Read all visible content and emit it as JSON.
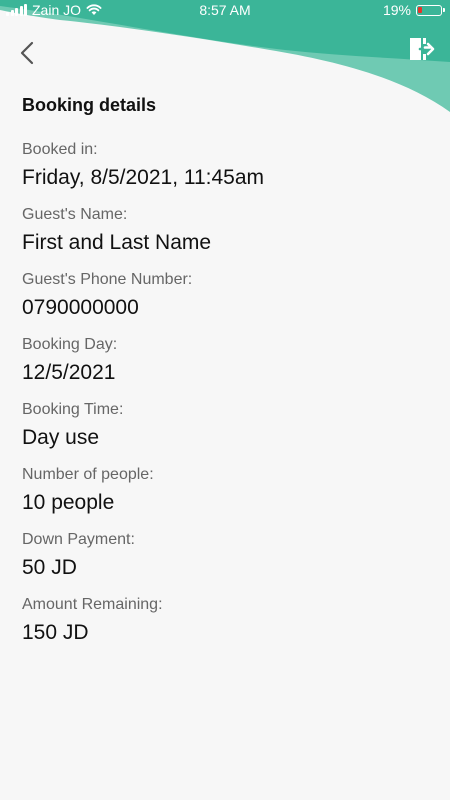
{
  "status_bar": {
    "carrier": "Zain JO",
    "time": "8:57 AM",
    "battery": "19%",
    "battery_level": 0.19
  },
  "header": {
    "title": "Booking details",
    "accent_color": "#3bb598",
    "accent_light_color": "#6fcab3"
  },
  "details": [
    {
      "label": "Booked in:",
      "value": "Friday, 8/5/2021, 11:45am"
    },
    {
      "label": "Guest's Name:",
      "value": "First and Last Name"
    },
    {
      "label": "Guest's Phone Number:",
      "value": "0790000000"
    },
    {
      "label": "Booking Day:",
      "value": "12/5/2021"
    },
    {
      "label": "Booking Time:",
      "value": "Day use"
    },
    {
      "label": "Number of people:",
      "value": "10 people"
    },
    {
      "label": "Down Payment:",
      "value": "50 JD"
    },
    {
      "label": "Amount Remaining:",
      "value": "150 JD"
    }
  ]
}
